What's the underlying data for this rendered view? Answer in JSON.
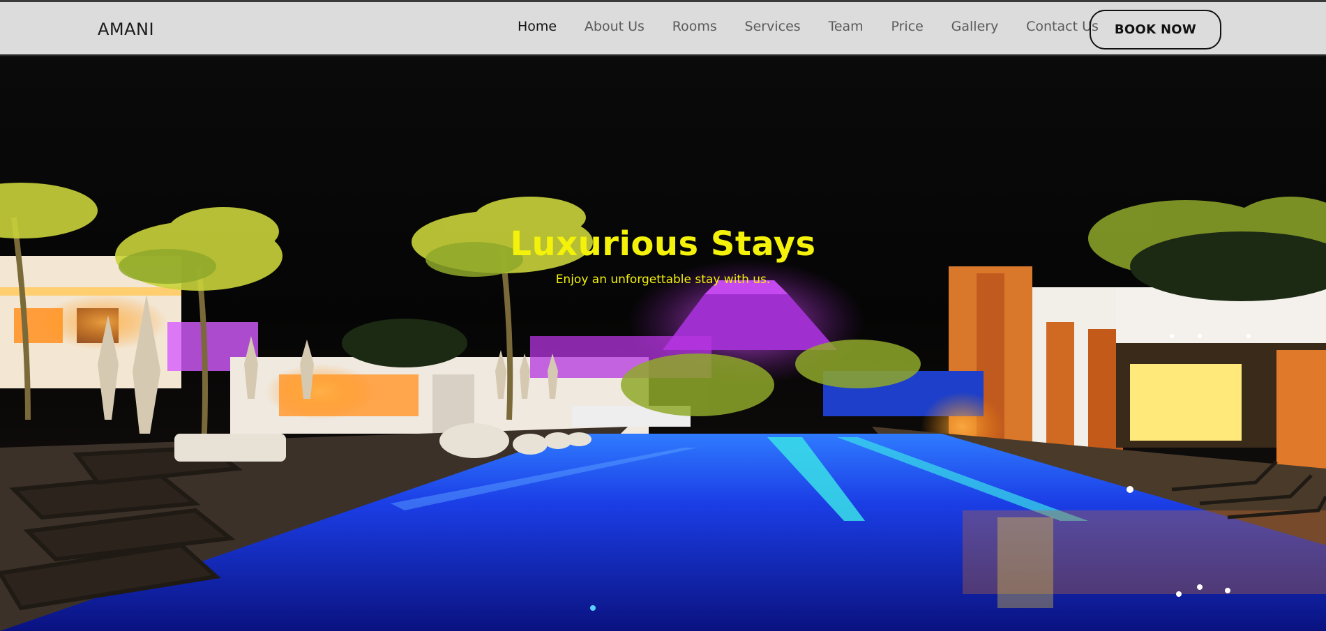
{
  "brand": {
    "name": "AMANI"
  },
  "nav": {
    "items": [
      {
        "label": "Home"
      },
      {
        "label": "About Us"
      },
      {
        "label": "Rooms"
      },
      {
        "label": "Services"
      },
      {
        "label": "Team"
      },
      {
        "label": "Price"
      },
      {
        "label": "Gallery"
      },
      {
        "label": "Contact Us"
      }
    ],
    "active": "Home",
    "cta": "BOOK NOW"
  },
  "hero": {
    "title": "Luxurious Stays",
    "subtitle": "Enjoy an unforgettable stay with us.",
    "image": "night-resort-pool-photo"
  },
  "colors": {
    "navbar_bg": "#dcdcdc",
    "hero_text": "#f4f20a",
    "pool_blue": "#1a2fd6",
    "neon_purple": "#c93ff0"
  }
}
